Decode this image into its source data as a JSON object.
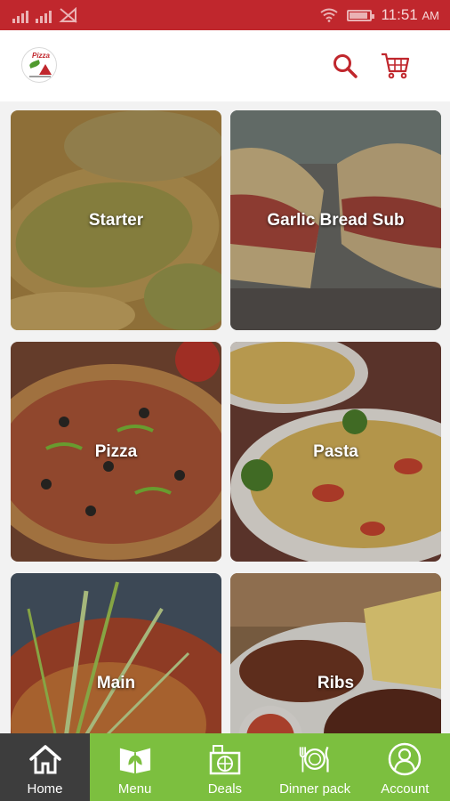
{
  "status_bar": {
    "time": "11:51",
    "ampm": "AM",
    "icons": [
      "signal-icon",
      "signal-icon",
      "no-signal-icon",
      "wifi-icon",
      "battery-icon"
    ]
  },
  "header": {
    "logo_text": "Pizza",
    "icons": [
      "search-icon",
      "cart-icon"
    ],
    "accent_color": "#c0272d"
  },
  "categories": [
    {
      "label": "Starter"
    },
    {
      "label": "Garlic Bread Sub"
    },
    {
      "label": "Pizza"
    },
    {
      "label": "Pasta"
    },
    {
      "label": "Main"
    },
    {
      "label": "Ribs"
    }
  ],
  "bottom_nav": {
    "items": [
      {
        "label": "Home",
        "icon": "home-icon",
        "active": true
      },
      {
        "label": "Menu",
        "icon": "menu-book-icon",
        "active": false
      },
      {
        "label": "Deals",
        "icon": "deals-icon",
        "active": false
      },
      {
        "label": "Dinner pack",
        "icon": "dinner-icon",
        "active": false
      },
      {
        "label": "Account",
        "icon": "account-icon",
        "active": false
      }
    ],
    "bar_color": "#7cbf3f",
    "active_color": "#3d3d3d"
  }
}
